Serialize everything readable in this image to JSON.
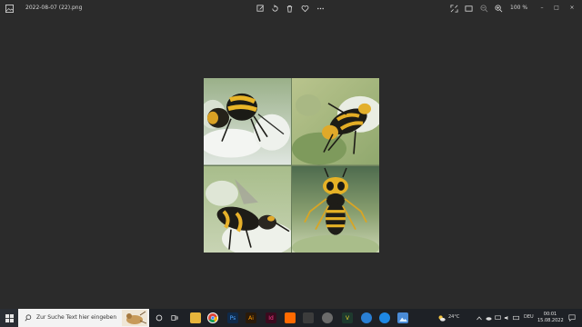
{
  "window": {
    "filename": "2022-08-07 (22).png",
    "zoom": "100 %"
  },
  "toolbar": {
    "icons": [
      "edit-image-icon",
      "rotate-icon",
      "delete-icon",
      "favorite-icon",
      "more-icon"
    ]
  },
  "right_controls": {
    "icons": [
      "fullscreen-icon",
      "fit-window-icon",
      "zoom-out-icon",
      "zoom-in-icon"
    ]
  },
  "window_controls": {
    "minimize": "–",
    "maximize": "□",
    "close": "×"
  },
  "viewer": {
    "tiles": [
      "wasp-tile-1",
      "wasp-tile-2",
      "wasp-tile-3",
      "wasp-tile-4"
    ]
  },
  "taskbar": {
    "search_placeholder": "Zur Suche Text hier eingeben",
    "pinned_apps": [
      {
        "name": "task-view",
        "color": "#2a2e34"
      },
      {
        "name": "file-explorer",
        "color": "#e7b53c"
      },
      {
        "name": "chrome",
        "color": "#db4437"
      },
      {
        "name": "photoshop",
        "color": "#1c3d6e"
      },
      {
        "name": "illustrator",
        "color": "#ff7c00"
      },
      {
        "name": "indesign",
        "color": "#d4145a"
      },
      {
        "name": "app-orange",
        "color": "#ff6a00"
      },
      {
        "name": "app-dark",
        "color": "#3c3c3c"
      },
      {
        "name": "app-gray",
        "color": "#6b6b6b"
      },
      {
        "name": "app-yellow-v",
        "color": "#1e3a2e"
      },
      {
        "name": "app-blue-1",
        "color": "#2a7fd4"
      },
      {
        "name": "app-blue-2",
        "color": "#1e88e5"
      },
      {
        "name": "photos",
        "color": "#4a8bd6"
      }
    ],
    "weather": "24°C",
    "language": "DEU",
    "time": "00:01",
    "date": "15.08.2022"
  }
}
